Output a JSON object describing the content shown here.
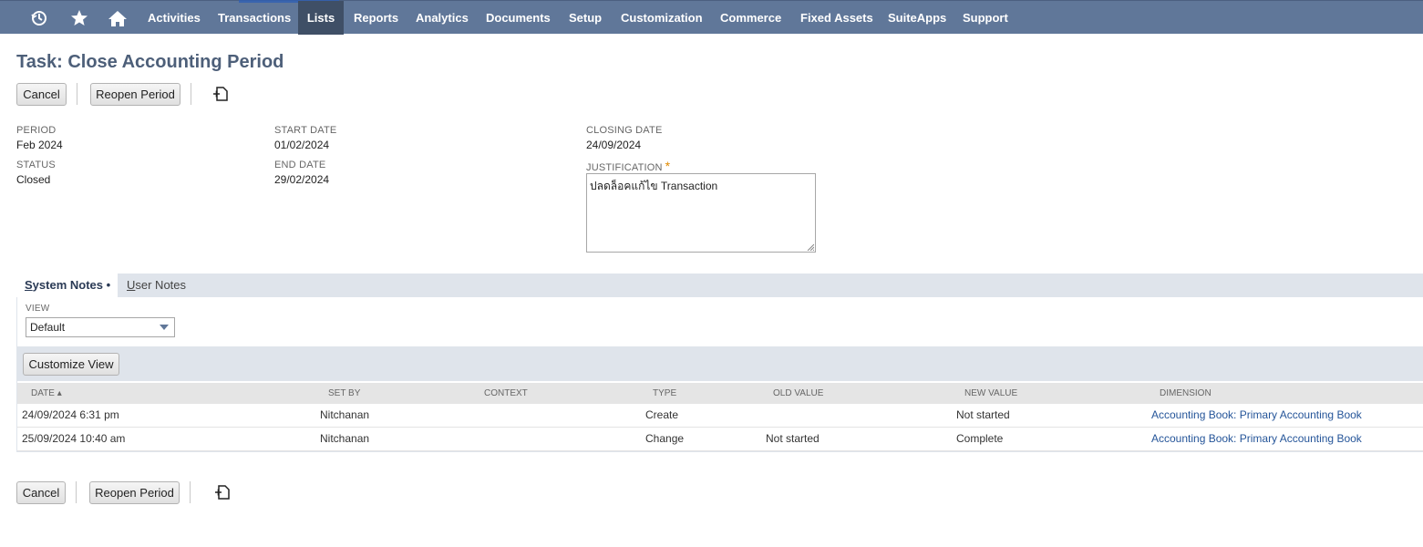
{
  "nav": {
    "icons": [
      "history-icon",
      "star-icon",
      "home-icon"
    ],
    "items": [
      "Activities",
      "Transactions",
      "Lists",
      "Reports",
      "Analytics",
      "Documents",
      "Setup",
      "Customization",
      "Commerce",
      "Fixed Assets",
      "SuiteApps",
      "Support"
    ],
    "active": "Lists",
    "color": "#607799"
  },
  "page": {
    "title": "Task: Close Accounting Period"
  },
  "toolbar": {
    "cancel_label": "Cancel",
    "reopen_label": "Reopen Period",
    "copy_icon": "copy-icon"
  },
  "fields": {
    "period": {
      "label": "PERIOD",
      "value": "Feb 2024"
    },
    "status": {
      "label": "STATUS",
      "value": "Closed"
    },
    "start_date": {
      "label": "START DATE",
      "value": "01/02/2024"
    },
    "end_date": {
      "label": "END DATE",
      "value": "29/02/2024"
    },
    "closing_date": {
      "label": "CLOSING DATE",
      "value": "24/09/2024"
    },
    "justification": {
      "label": "JUSTIFICATION",
      "required_mark": "*",
      "value": "ปลดล็อคแก้ไข Transaction"
    }
  },
  "subtabs": {
    "system_notes": {
      "label_first": "S",
      "label_rest": "ystem Notes",
      "dot": "•"
    },
    "user_notes": {
      "label_first": "U",
      "label_rest": "ser Notes"
    }
  },
  "view": {
    "label": "VIEW",
    "value": "Default"
  },
  "customize_view_label": "Customize View",
  "table": {
    "columns": [
      "DATE ▴",
      "SET BY",
      "CONTEXT",
      "TYPE",
      "OLD VALUE",
      "NEW VALUE",
      "DIMENSION"
    ],
    "rows": [
      {
        "date": "24/09/2024 6:31 pm",
        "set_by": "Nitchanan",
        "context": "",
        "type": "Create",
        "old_value": "",
        "new_value": "Not started",
        "dimension": "Accounting Book: Primary Accounting Book"
      },
      {
        "date": "25/09/2024 10:40 am",
        "set_by": "Nitchanan",
        "context": "",
        "type": "Change",
        "old_value": "Not started",
        "new_value": "Complete",
        "dimension": "Accounting Book: Primary Accounting Book"
      }
    ]
  }
}
